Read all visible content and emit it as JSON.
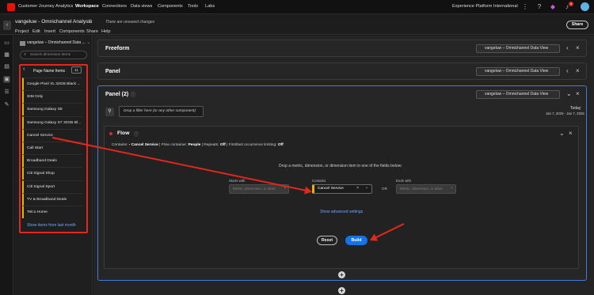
{
  "topnav": {
    "app_title": "Customer Journey Analytics",
    "items": [
      "Workspace",
      "Connections",
      "Data views",
      "Components",
      "Tools",
      "Labs"
    ],
    "org": "Experience Platform International",
    "notif_count": "4"
  },
  "project": {
    "title": "vangeluw - Omnichannel Analysis",
    "unsaved": "There are unsaved changes",
    "menus": [
      "Project",
      "Edit",
      "Insert",
      "Components",
      "Share",
      "Help"
    ],
    "share_label": "Share"
  },
  "leftpanel": {
    "dataview": "vangeluw – Omnichannel Data ...",
    "search_placeholder": "Search dimension items",
    "dim_header": "Page Name Items",
    "items": [
      "Google Pixel XL 32GB Black ...",
      "SIM Only",
      "Samsung Galaxy S8",
      "Samsung Galaxy S7 32GB Bl...",
      "Cancel Service",
      "Call Start",
      "Broadband Deals",
      "Citi Signal Shop",
      "Citi Signal Sport",
      "TV & Broadband Deals",
      "Telco Home"
    ],
    "show_more": "Show items from last month"
  },
  "panels": {
    "freeform_title": "Freeform",
    "panel_title": "Panel",
    "panel2_title": "Panel (2)",
    "dataview": "vangeluw – Omnichannel Data View",
    "filter_drop": "Drop a filter here (or any other component)",
    "date_label": "Today",
    "date_range": "Jan 7, 2025 - Jan 7, 2025"
  },
  "flow": {
    "title": "Flow",
    "contains_label": "Contains:",
    "contains_value": "Cancel Service",
    "sep1": "|",
    "container_label": "Flow container:",
    "container_value": "People",
    "sep2": "|",
    "repeats_label": "Repeats:",
    "repeats_value": "Off",
    "sep3": "|",
    "firstlast_label": "First/last occurrence limiting:",
    "firstlast_value": "Off",
    "instruction": "Drop a metric, dimension, or dimension item in one of the fields below:",
    "starts_with_label": "Starts with",
    "starts_with_placeholder": "Metric, dimension, or dime",
    "contains_field_label": "Contains",
    "contains_field_value": "Cancel Service",
    "or_label": "OR",
    "ends_with_label": "Ends with",
    "ends_with_placeholder": "Metric, dimension, or dime",
    "advanced": "Show advanced settings",
    "reset": "Reset",
    "build": "Build"
  },
  "colors": {
    "accent_red": "#e3271c",
    "build_blue": "#1473e6",
    "dim_yellow": "#e6b300"
  }
}
